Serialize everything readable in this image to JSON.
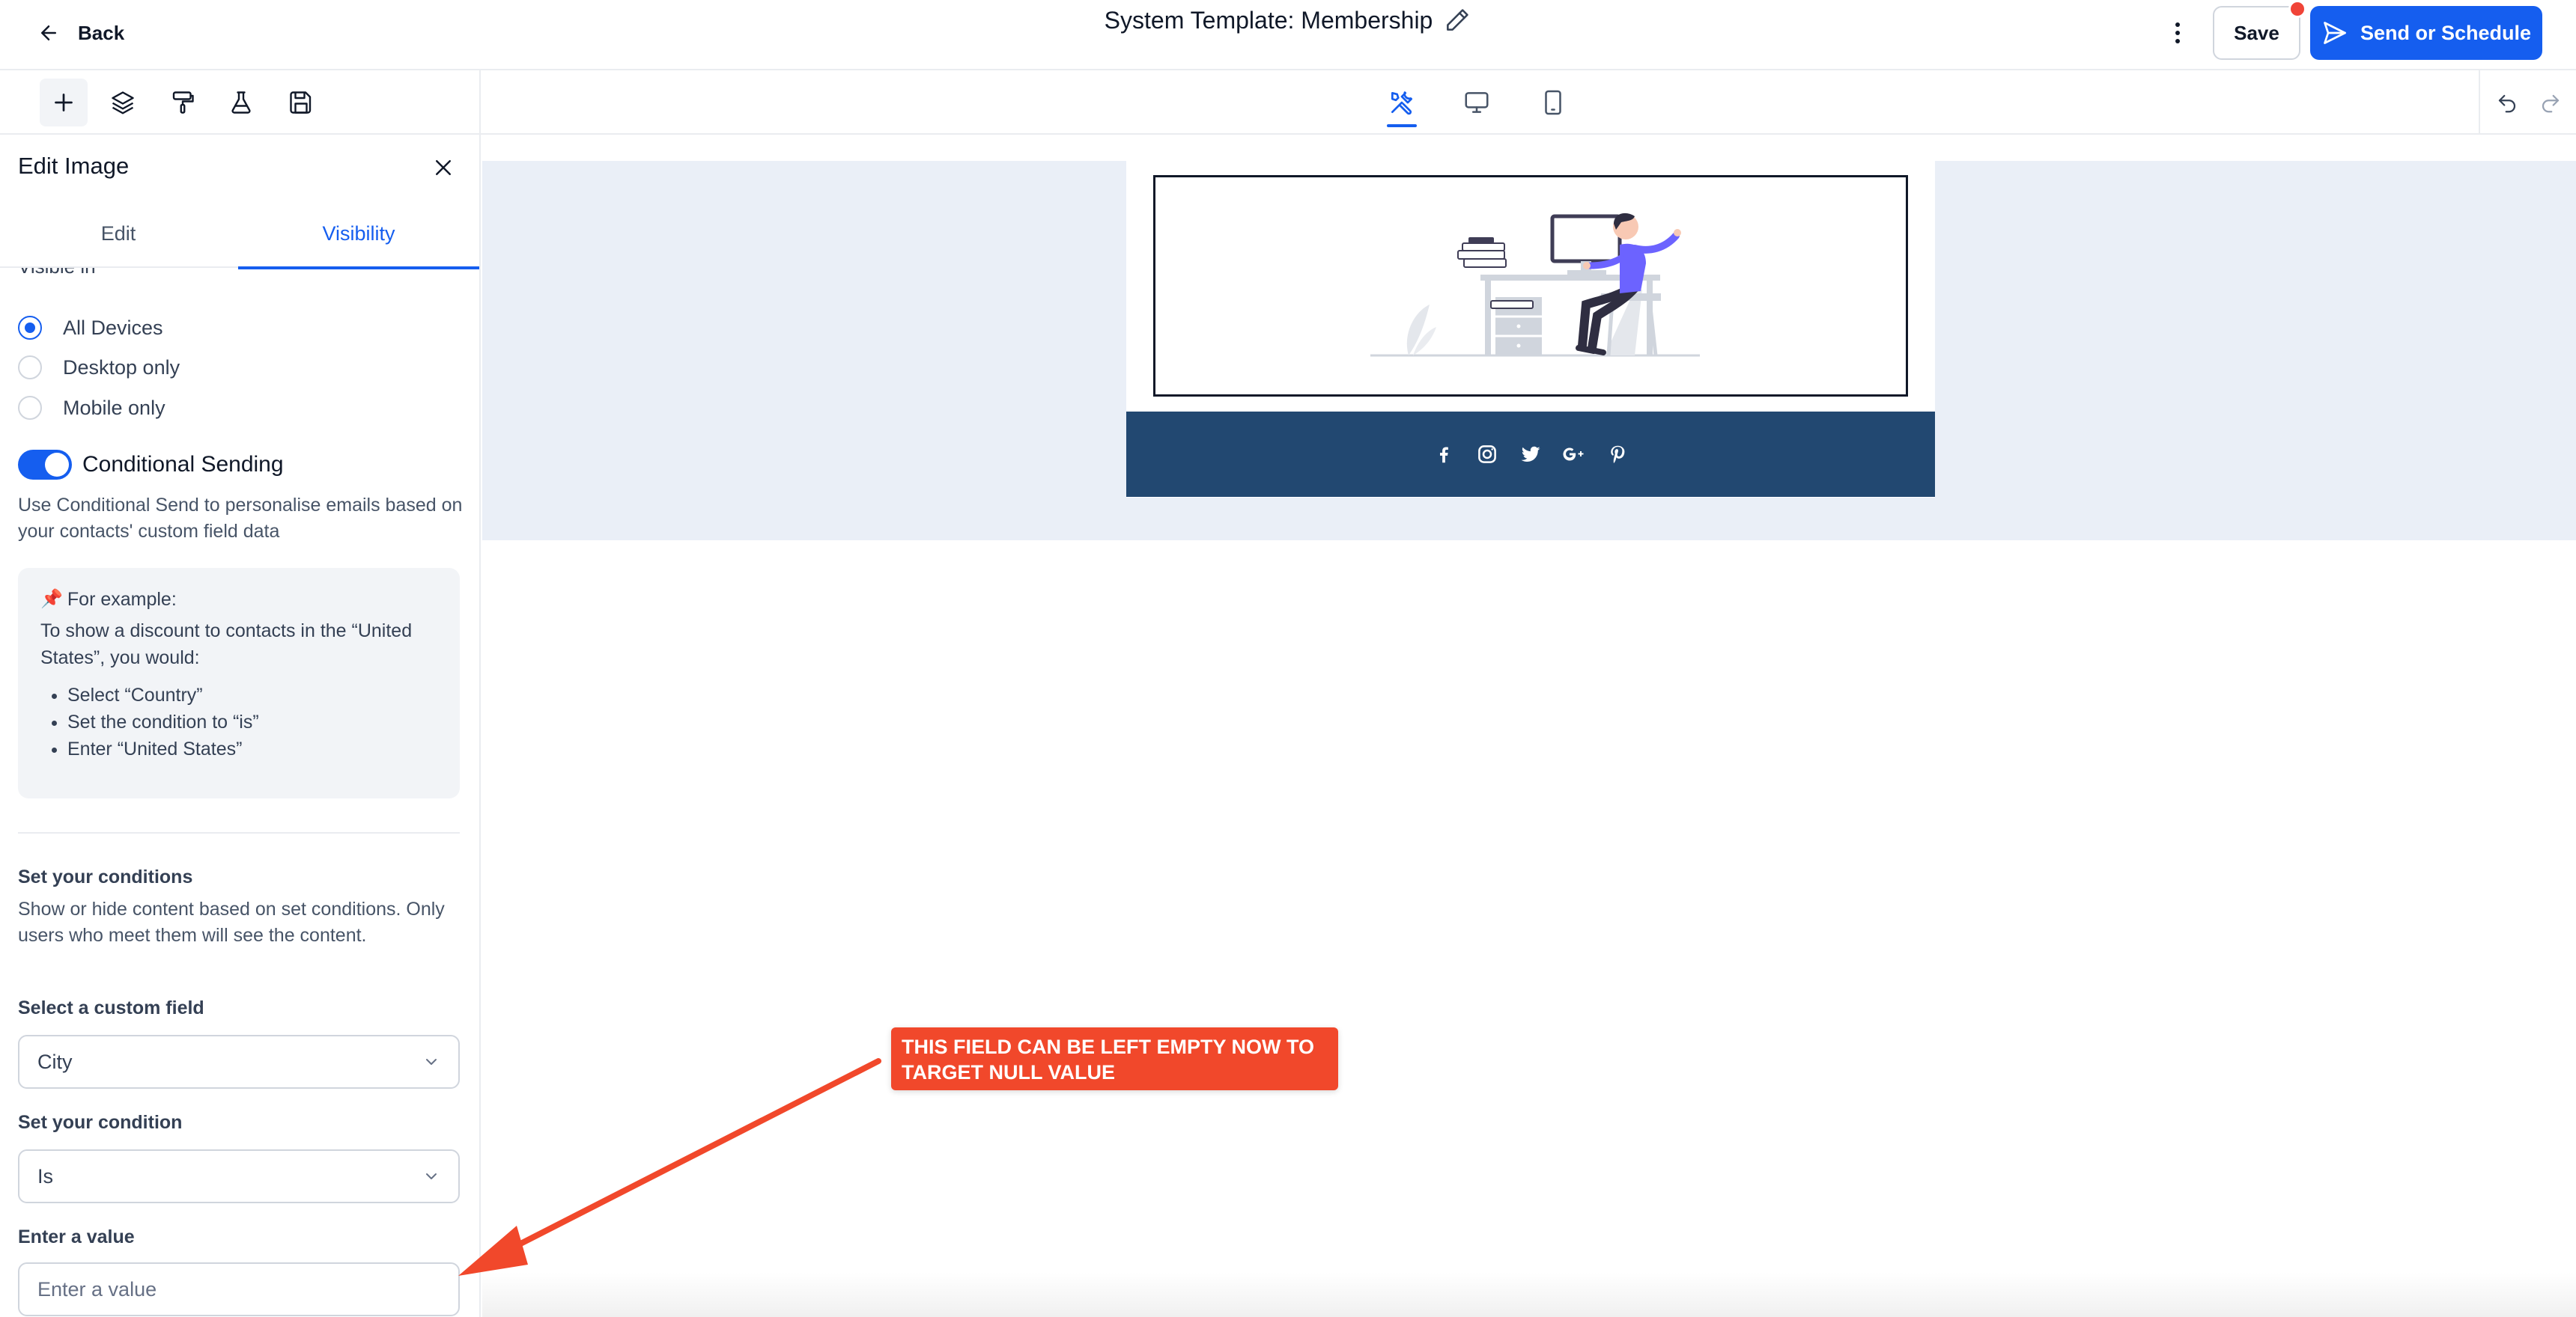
{
  "header": {
    "back_label": "Back",
    "title": "System Template: Membership",
    "save_label": "Save",
    "send_label": "Send or Schedule"
  },
  "toolbar": {
    "tools": [
      "add-icon",
      "layers-icon",
      "paint-roller-icon",
      "flask-icon",
      "save-icon"
    ],
    "views": [
      "build-tools-icon",
      "desktop-icon",
      "mobile-icon"
    ],
    "active_view": "build-tools-icon"
  },
  "panel": {
    "title": "Edit Image",
    "tabs": [
      {
        "label": "Edit"
      },
      {
        "label": "Visibility"
      }
    ],
    "active_tab": "Visibility",
    "visible_in_label": "Visible in",
    "devices": [
      {
        "label": "All Devices",
        "selected": true
      },
      {
        "label": "Desktop only",
        "selected": false
      },
      {
        "label": "Mobile only",
        "selected": false
      }
    ],
    "conditional": {
      "label": "Conditional Sending",
      "enabled": true,
      "description": "Use Conditional Send to personalise emails based on your contacts' custom field data"
    },
    "example": {
      "title": "For example:",
      "intro": "To show a discount to contacts in the “United States”, you would:",
      "steps": [
        "Select “Country”",
        "Set the condition to “is”",
        "Enter “United States”"
      ]
    },
    "conditions": {
      "title": "Set your conditions",
      "description": "Show or hide content based on set conditions. Only users who meet them will see the content.",
      "field_label": "Select a custom field",
      "field_value": "City",
      "condition_label": "Set your condition",
      "condition_value": "Is",
      "value_label": "Enter a value",
      "value_placeholder": "Enter a value",
      "value": ""
    }
  },
  "canvas": {
    "footer_social": [
      "facebook-icon",
      "instagram-icon",
      "twitter-icon",
      "google-plus-icon",
      "pinterest-icon"
    ],
    "footer_color": "#224871"
  },
  "annotation": {
    "text": "THIS FIELD CAN BE LEFT EMPTY NOW TO TARGET NULL VALUE",
    "color": "#f1482b"
  },
  "colors": {
    "accent": "#155eef",
    "canvas_bg": "#eaeff7"
  }
}
